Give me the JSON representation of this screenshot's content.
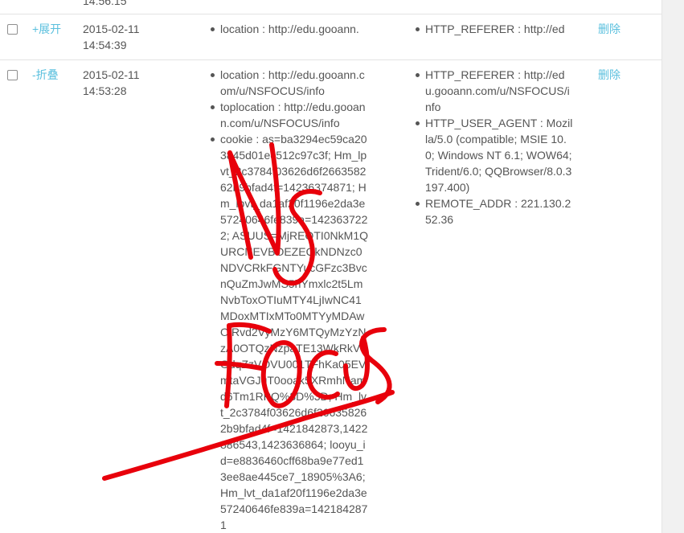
{
  "top_row": {
    "time_fragment": "14:56:15"
  },
  "rows": [
    {
      "toggle_label": "+展开",
      "date": "2015-02-11",
      "time": "14:54:39",
      "col1_items": [
        "location : http://edu.gooann."
      ],
      "col2_items": [
        "HTTP_REFERER : http://ed"
      ],
      "delete_label": "删除"
    },
    {
      "toggle_label": "-折叠",
      "date": "2015-02-11",
      "time": "14:53:28",
      "col1_items": [
        "location : http://edu.gooann.com/u/NSFOCUS/info",
        "toplocation : http://edu.gooann.com/u/NSFOCUS/info",
        "cookie : as=ba3294ec59ca203845d01ec512c97c3f; Hm_lpvt_2c3784f03626d6f266358262b9bfad4f=14236374871; Hm_lpvt_da1af20f1196e2da3e57240646fe839a=1423637222; ASUUS=MjREOTI0NkM1QURCNEVBOEZEQkNDNzc0NDVCRkFGNTYucGFzc3BvcnQuZmJwMS5hYmxlc2t5LmNvbToxOTIuMTY4LjIwNC41MDoxMTIxMTo0MTYyMDAwOlRvd2VyMzY6MTQyMzYzNzA0OTQzNzpaTE13WkRkVGdqZzVOVU001TFhKa05EVmtaVGJqT0ooak5XRmhNamd6Tm1RPQ%3D%3D; Hm_lvt_2c3784f03626d6f266358262b9bfad4f=1421842873,1422886543,1423636864; looyu_id=e8836460cff68ba9e77ed13ee8ae445ce7_18905%3A6; Hm_lvt_da1af20f1196e2da3e57240646fe839a=1421842871"
      ],
      "col2_items": [
        "HTTP_REFERER : http://edu.gooann.com/u/NSFOCUS/info",
        "HTTP_USER_AGENT : Mozilla/5.0 (compatible; MSIE 10.0; Windows NT 6.1; WOW64; Trident/6.0; QQBrowser/8.0.3197.400)",
        "REMOTE_ADDR : 221.130.252.36"
      ],
      "delete_label": "删除"
    }
  ],
  "annotation": {
    "color": "#e8000b"
  }
}
